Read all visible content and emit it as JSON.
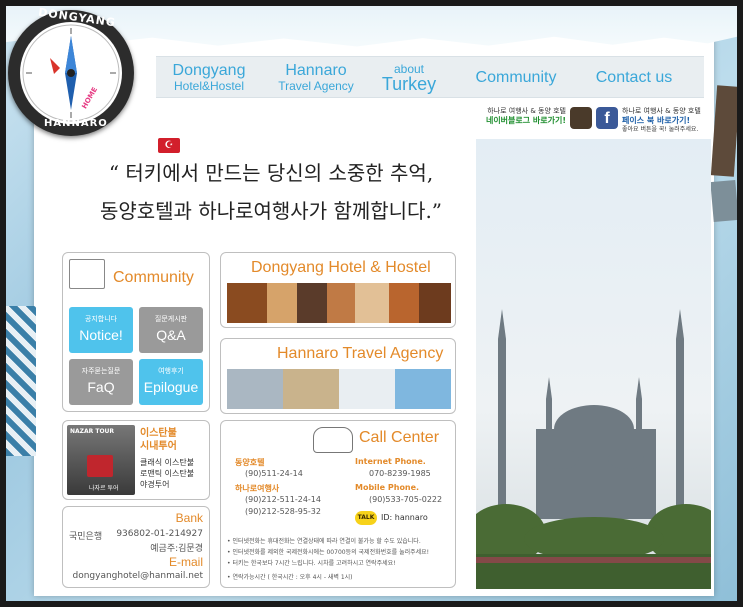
{
  "nav": {
    "items": [
      {
        "big": "Dongyang",
        "small": "Hotel&Hostel"
      },
      {
        "big": "Hannaro",
        "small": "Travel Agency"
      },
      {
        "small": "about",
        "big": "Turkey"
      },
      {
        "big": "Community"
      },
      {
        "big": "Contact us"
      }
    ]
  },
  "compass": {
    "top": "DONGYANG",
    "bottom": "HANNARO",
    "center": "HOME"
  },
  "sns": {
    "blog": {
      "line1": "하나로 여행사 & 동양 호텔",
      "line2": "네이버블로그 바로가기!"
    },
    "facebook": {
      "line1": "하나로 여행사 & 동양 호텔",
      "line2": "페이스 북 바로가기!",
      "line3": "좋아요 버튼을 꾹! 눌러주세요."
    }
  },
  "slogan": {
    "line1": "“ 터키에서 만드는 당신의 소중한 추억,",
    "line2": "동양호텔과 하나로여행사가 함께합니다.”"
  },
  "community": {
    "title": "Community",
    "tiles": [
      {
        "small": "공지합니다",
        "large": "Notice!",
        "color": "#4fc3ec"
      },
      {
        "small": "질문게시판",
        "large": "Q&A",
        "color": "#9a9a9a"
      },
      {
        "small": "자주묻는질문",
        "large": "FaQ",
        "color": "#9a9a9a"
      },
      {
        "small": "여행후기",
        "large": "Epilogue",
        "color": "#4fc3ec"
      }
    ]
  },
  "hotel": {
    "title": "Dongyang Hotel & Hostel"
  },
  "travel": {
    "title": "Hannaro Travel Agency"
  },
  "tour": {
    "photo_label": "NAZAR TOUR",
    "photo_caption": "나자르 투어",
    "title1": "이스탄불",
    "title2": "시내투어",
    "items": [
      "클래식 이스탄불",
      "로맨틱 이스탄불",
      "야경투어"
    ]
  },
  "bank": {
    "title": "Bank",
    "bank_name": "국민은행",
    "account": "936802-01-214927",
    "holder": "예금주:김문경",
    "email_title": "E-mail",
    "email": "dongyanghotel@hanmail.net"
  },
  "call": {
    "title": "Call Center",
    "hotel_label": "동양호텔",
    "hotel_phone": "(90)511-24-14",
    "agency_label": "하나로여행사",
    "agency_phone1": "(90)212-511-24-14",
    "agency_phone2": "(90)212-528-95-32",
    "internet_label": "Internet Phone.",
    "internet_phone": "070-8239-1985",
    "mobile_label": "Mobile Phone.",
    "mobile_phone": "(90)533-705-0222",
    "kakao_badge": "TALK",
    "kakao_id": "ID: hannaro",
    "notes": [
      "• 인터넷전화는 휴대전화는 연결상태에 따라 연결이 불가능 할 수도 있습니다.",
      "• 인터넷전화를 제외한 국제전화시에는 00700등의 국제전화번호를 눌러주세요!",
      "• 터키는 한국보다 7시간 느립니다. 시차를 고려하시고 연락주세요!",
      "• 연락가능시간 ( 한국시간 : 오후 4시 - 새벽 1시)"
    ]
  },
  "colors": {
    "accent_blue": "#3aa7d9",
    "accent_orange": "#e38a2a",
    "tile_blue": "#4fc3ec",
    "tile_gray": "#9a9a9a"
  }
}
